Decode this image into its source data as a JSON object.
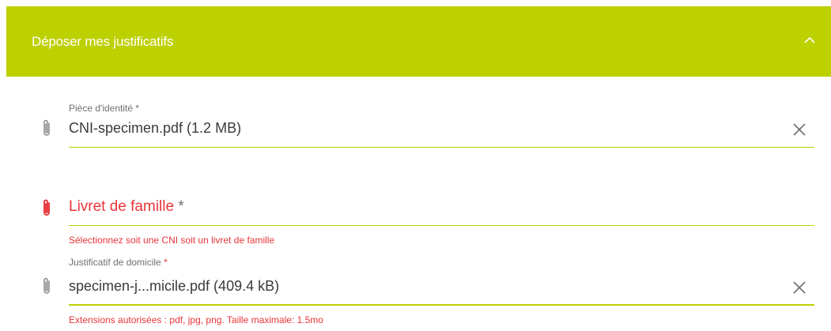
{
  "panel": {
    "title": "Déposer mes justificatifs",
    "expanded": true,
    "accent_color": "#bdd000"
  },
  "fields": {
    "identity": {
      "label": "Pièce d'identité",
      "required_mark": "*",
      "value": "CNI-specimen.pdf (1.2 MB)"
    },
    "family_book": {
      "placeholder": "Livret de famille",
      "required_mark": "*",
      "error": "Sélectionnez soit une CNI soit un livret de famille",
      "error_color": "#e8353a"
    },
    "address": {
      "label": "Justificatif de domicile",
      "required_mark": "*",
      "value": "specimen-j...micile.pdf (409.4 kB)",
      "hint": "Extensions autorisées : pdf, jpg, png. Taille maximale: 1.5mo"
    }
  },
  "icons": {
    "attach": "paperclip-icon",
    "clear": "close-icon",
    "toggle": "chevron-up-icon"
  }
}
